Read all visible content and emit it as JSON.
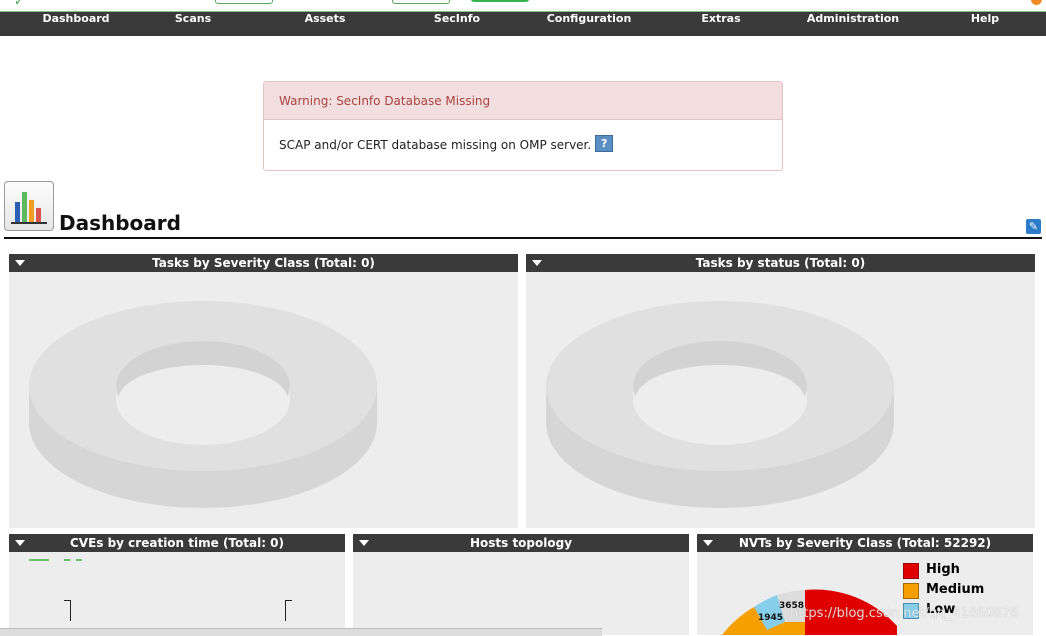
{
  "nav": {
    "items": [
      "Dashboard",
      "Scans",
      "Assets",
      "SecInfo",
      "Configuration",
      "Extras",
      "Administration",
      "Help"
    ]
  },
  "warning": {
    "title": "Warning: SecInfo Database Missing",
    "message": "SCAP and/or CERT database missing on OMP server.",
    "help_icon": "?"
  },
  "dashboard": {
    "title": "Dashboard",
    "settings_icon": "wrench-icon"
  },
  "panels": {
    "tasks_severity": {
      "title": "Tasks by Severity Class (Total: 0)"
    },
    "tasks_status": {
      "title": "Tasks by status (Total: 0)"
    },
    "cves": {
      "title": "CVEs by creation time (Total: 0)"
    },
    "hosts": {
      "title": "Hosts topology"
    },
    "nvts": {
      "title": "NVTs by Severity Class (Total: 52292)",
      "legend": [
        {
          "label": "High",
          "color": "#d40000"
        },
        {
          "label": "Medium",
          "color": "#f5a000"
        },
        {
          "label": "Low",
          "color": "#87ceeb"
        }
      ],
      "slice_labels": [
        "3658",
        "1945"
      ]
    }
  },
  "chart_data": {
    "type": "pie",
    "title": "NVTs by Severity Class (Total: 52292)",
    "categories": [
      "High",
      "Medium",
      "Low"
    ],
    "data_labels": [
      3658,
      1945
    ],
    "colors": {
      "High": "#d40000",
      "Medium": "#f5a000",
      "Low": "#87ceeb"
    }
  },
  "watermark": "https://blog.csdn.net/qq_41860876"
}
